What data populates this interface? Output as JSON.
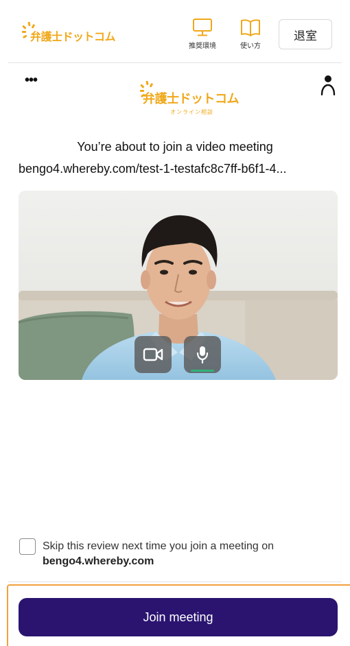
{
  "header": {
    "logo_text": "弁護士ドットコム",
    "nav": [
      {
        "label": "推奨環境",
        "icon": "monitor-icon"
      },
      {
        "label": "使い方",
        "icon": "book-icon"
      }
    ],
    "leave_label": "退室"
  },
  "meeting": {
    "logo_text": "弁護士ドットコム",
    "logo_sub": "オンライン相談",
    "heading": "You’re about to join a video meeting",
    "room_url": "bengo4.whereby.com/test-1-testafc8c7ff-b6f1-4...",
    "icons": {
      "menu": "more-dots-icon",
      "account": "person-icon",
      "camera": "camera-icon",
      "mic": "microphone-icon"
    },
    "mic_level": 0.6
  },
  "skip_review": {
    "checked": false,
    "text": "Skip this review next time you join a meeting on",
    "domain": "bengo4.whereby.com"
  },
  "footer": {
    "join_label": "Join meeting"
  },
  "colors": {
    "brand_orange": "#f0a81a",
    "join_button": "#2a1470",
    "highlight": "#f2a03d",
    "mic_level": "#2fb37a"
  }
}
